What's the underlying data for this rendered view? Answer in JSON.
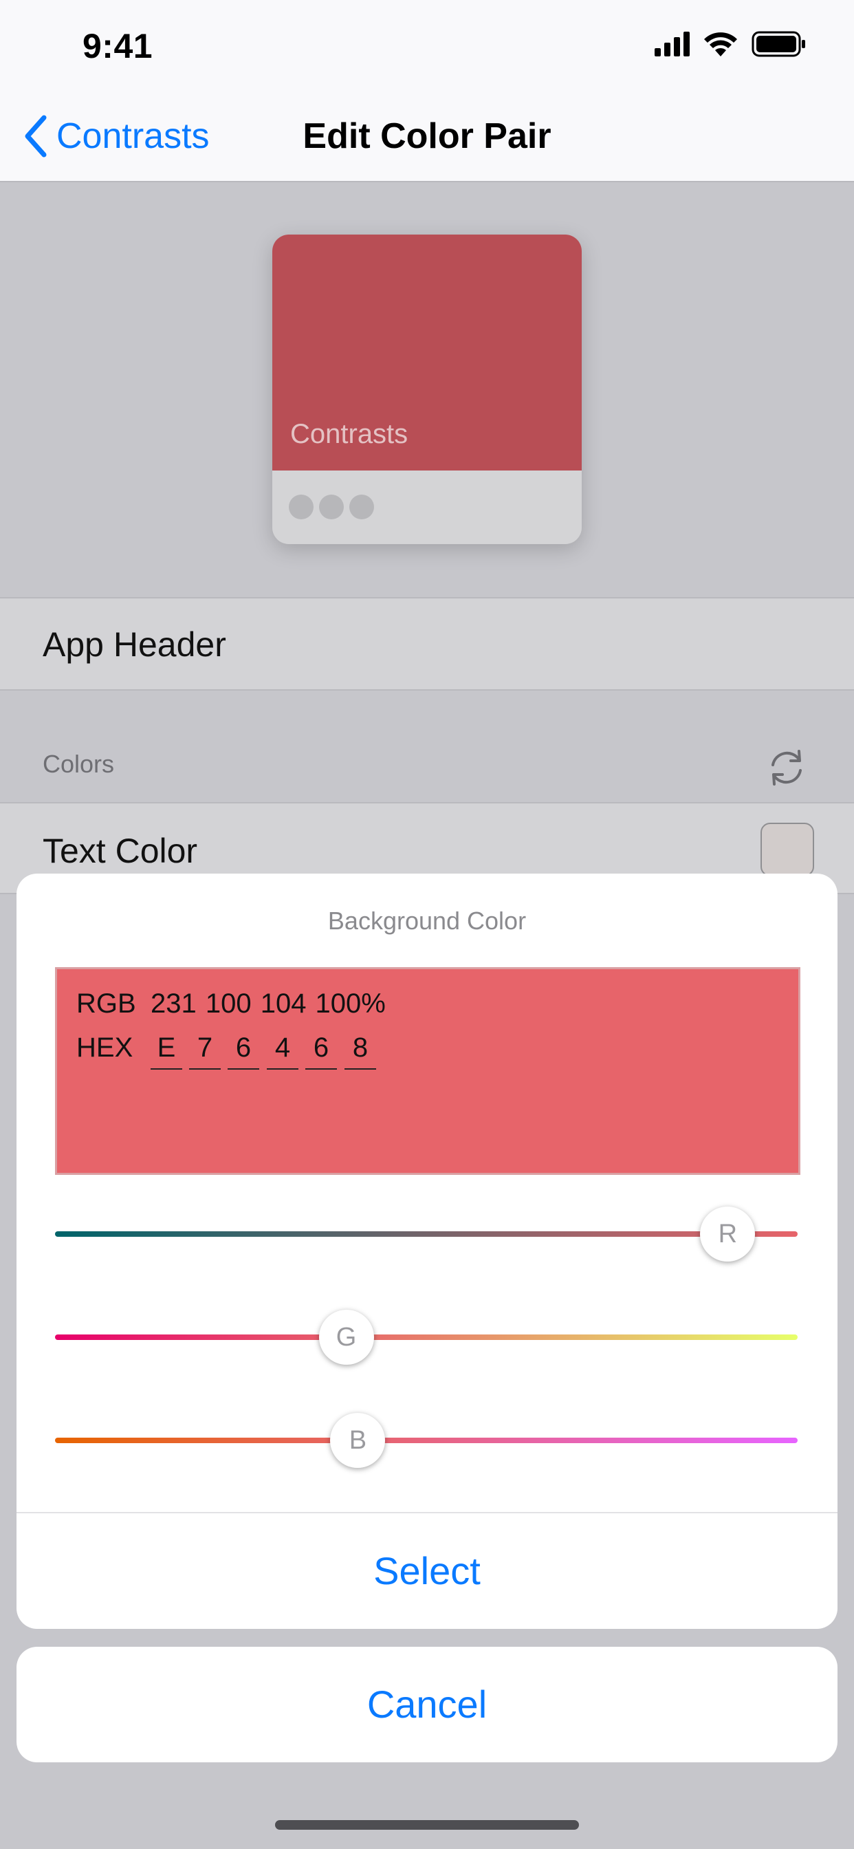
{
  "status_bar": {
    "time": "9:41"
  },
  "nav": {
    "back_label": "Contrasts",
    "title": "Edit Color Pair"
  },
  "preview": {
    "app_name": "Contrasts",
    "header_color": "#b84e55"
  },
  "list": {
    "app_header_label": "App Header",
    "section_colors": "Colors",
    "text_color_label": "Text Color",
    "text_color_swatch": "#d2cccb"
  },
  "sheet": {
    "title": "Background Color",
    "rgb_label": "RGB",
    "rgb_values": "231 100 104 100%",
    "hex_label": "HEX",
    "hex_digits": [
      "E",
      "7",
      "6",
      "4",
      "6",
      "8"
    ],
    "color": "#e7646a",
    "sliders": [
      {
        "label": "R",
        "value": 231,
        "max": 255
      },
      {
        "label": "G",
        "value": 100,
        "max": 255
      },
      {
        "label": "B",
        "value": 104,
        "max": 255
      }
    ],
    "select_label": "Select"
  },
  "cancel_label": "Cancel",
  "colors": {
    "accent": "#0a7aff"
  }
}
